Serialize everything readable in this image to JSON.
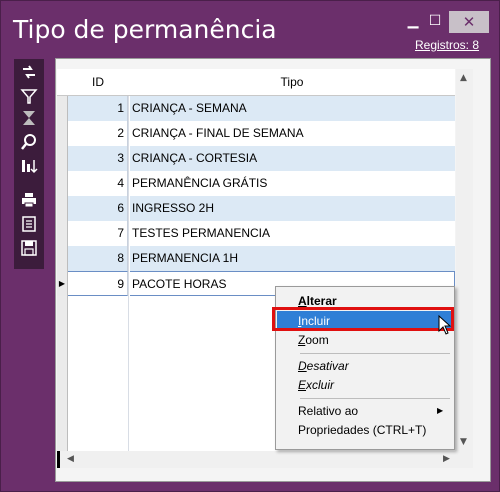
{
  "window": {
    "title": "Tipo de permanência",
    "minimize": "▁",
    "maximize": "☐",
    "close": "✕",
    "records_link": "Registros: 8"
  },
  "toolbar": {
    "icons": [
      "refresh-icon",
      "filter-icon",
      "clear-filter-icon",
      "search-icon",
      "sort-icon",
      "print-icon",
      "report-icon",
      "save-icon"
    ]
  },
  "grid": {
    "columns": [
      "ID",
      "Tipo"
    ],
    "rows": [
      {
        "id": "1",
        "tipo": "CRIANÇA - SEMANA"
      },
      {
        "id": "2",
        "tipo": "CRIANÇA - FINAL DE SEMANA"
      },
      {
        "id": "3",
        "tipo": "CRIANÇA - CORTESIA"
      },
      {
        "id": "4",
        "tipo": "PERMANÊNCIA GRÁTIS"
      },
      {
        "id": "6",
        "tipo": "INGRESSO 2H"
      },
      {
        "id": "7",
        "tipo": "TESTES PERMANENCIA"
      },
      {
        "id": "8",
        "tipo": "PERMANENCIA 1H"
      },
      {
        "id": "9",
        "tipo": "PACOTE HORAS"
      }
    ],
    "current_row_marker": "▶"
  },
  "context_menu": {
    "items": [
      {
        "label": "Alterar",
        "underline": "A",
        "rest": "lterar",
        "bold": true
      },
      {
        "label": "Incluir",
        "underline": "I",
        "rest": "ncluir",
        "selected": true
      },
      {
        "label": "Zoom",
        "underline": "Z",
        "rest": "oom"
      },
      {
        "label": "Desativar",
        "underline": "D",
        "rest": "esativar",
        "italic": true
      },
      {
        "label": "Excluir",
        "underline": "E",
        "rest": "xcluir",
        "italic": true
      },
      {
        "label": "Relativo ao",
        "submenu": true
      },
      {
        "label": "Propriedades (CTRL+T)"
      }
    ],
    "submenu_arrow": "▶"
  },
  "colors": {
    "window_frame": "#6b2f6b",
    "toolbar": "#3c1c3c",
    "row_alt": "#dce9f5",
    "menu_selected": "#2f7fd6",
    "highlight_box": "#e01010"
  }
}
